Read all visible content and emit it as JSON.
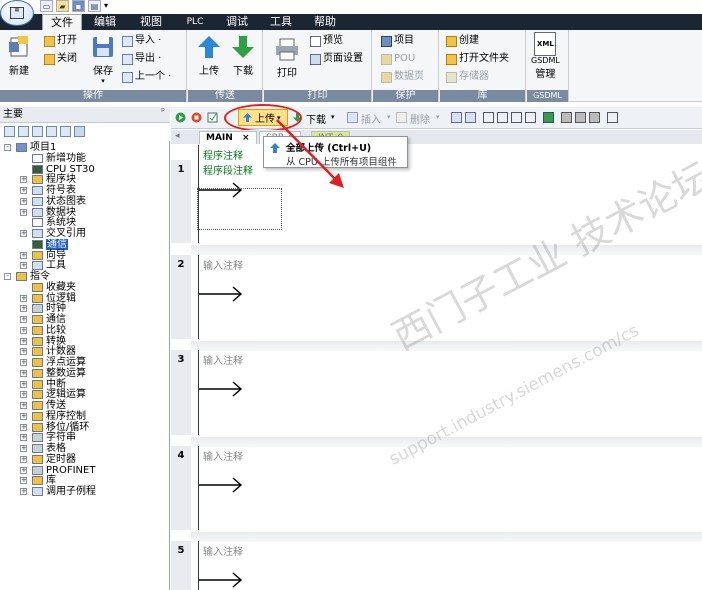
{
  "menu": {
    "items": [
      "文件",
      "编辑",
      "视图",
      "PLC",
      "调试",
      "工具",
      "帮助"
    ]
  },
  "ribbon": {
    "new_label": "新建",
    "open_label": "打开",
    "close_label": "关闭",
    "save_label": "保存",
    "import_label": "导入 ·",
    "export_label": "导出 ·",
    "previous_label": "上一个 ·",
    "upload_label": "上传",
    "download_label": "下载",
    "print_label": "打印",
    "preview_label": "预览",
    "page_setup_label": "页面设置",
    "project_label": "项目",
    "pou_label": "POU",
    "datapage_label": "数据页",
    "create_label": "创建",
    "open_folder_label": "打开文件夹",
    "storage_label": "存储器",
    "xml_label": "XML",
    "gsdml_label": "GSDML",
    "manage_label": "管理",
    "groups": {
      "operation": "操作",
      "transfer": "传送",
      "print": "打印",
      "protect": "保护",
      "library": "库",
      "gsdml": "GSDML"
    }
  },
  "left_panel": {
    "title": "主要",
    "pin": "ᵖ",
    "tree": [
      {
        "label": "项目1"
      },
      {
        "label": "新增功能"
      },
      {
        "label": "CPU ST30"
      },
      {
        "label": "程序块"
      },
      {
        "label": "符号表"
      },
      {
        "label": "状态图表"
      },
      {
        "label": "数据块"
      },
      {
        "label": "系统块"
      },
      {
        "label": "交叉引用"
      },
      {
        "label": "通信"
      },
      {
        "label": "向导"
      },
      {
        "label": "工具"
      },
      {
        "label": "指令"
      },
      {
        "label": "收藏夹"
      },
      {
        "label": "位逻辑"
      },
      {
        "label": "时钟"
      },
      {
        "label": "通信"
      },
      {
        "label": "比较"
      },
      {
        "label": "转换"
      },
      {
        "label": "计数器"
      },
      {
        "label": "浮点运算"
      },
      {
        "label": "整数运算"
      },
      {
        "label": "中断"
      },
      {
        "label": "逻辑运算"
      },
      {
        "label": "传送"
      },
      {
        "label": "程序控制"
      },
      {
        "label": "移位/循环"
      },
      {
        "label": "字符串"
      },
      {
        "label": "表格"
      },
      {
        "label": "定时器"
      },
      {
        "label": "PROFINET"
      },
      {
        "label": "库"
      },
      {
        "label": "调用子例程"
      }
    ]
  },
  "editor": {
    "toolbar": {
      "upload": "上传",
      "download": "下载",
      "insert": "插入",
      "delete": "删除"
    },
    "tabs": [
      "MAIN",
      "SBR_0",
      "INT_0"
    ],
    "tab_close": "×",
    "dropdown": {
      "title": "全部上传 (Ctrl+U)",
      "description": "从 CPU 上传所有项目组件"
    },
    "program_comment": "程序注释",
    "networks": [
      {
        "number": "1",
        "comment": "程序段注释"
      },
      {
        "number": "2",
        "comment": "输入注释"
      },
      {
        "number": "3",
        "comment": "输入注释"
      },
      {
        "number": "4",
        "comment": "输入注释"
      },
      {
        "number": "5",
        "comment": "输入注释"
      }
    ]
  },
  "watermark": {
    "line1": "西门子工业 技术论坛",
    "line2": "support.industry.siemens.com/cs"
  },
  "colors": {
    "menubar": "#1c2633",
    "upload_arrow": "#2b86d8",
    "download_arrow": "#2ea043",
    "annotation_red": "#e02020",
    "selected_tree": "#1f5fc5"
  }
}
